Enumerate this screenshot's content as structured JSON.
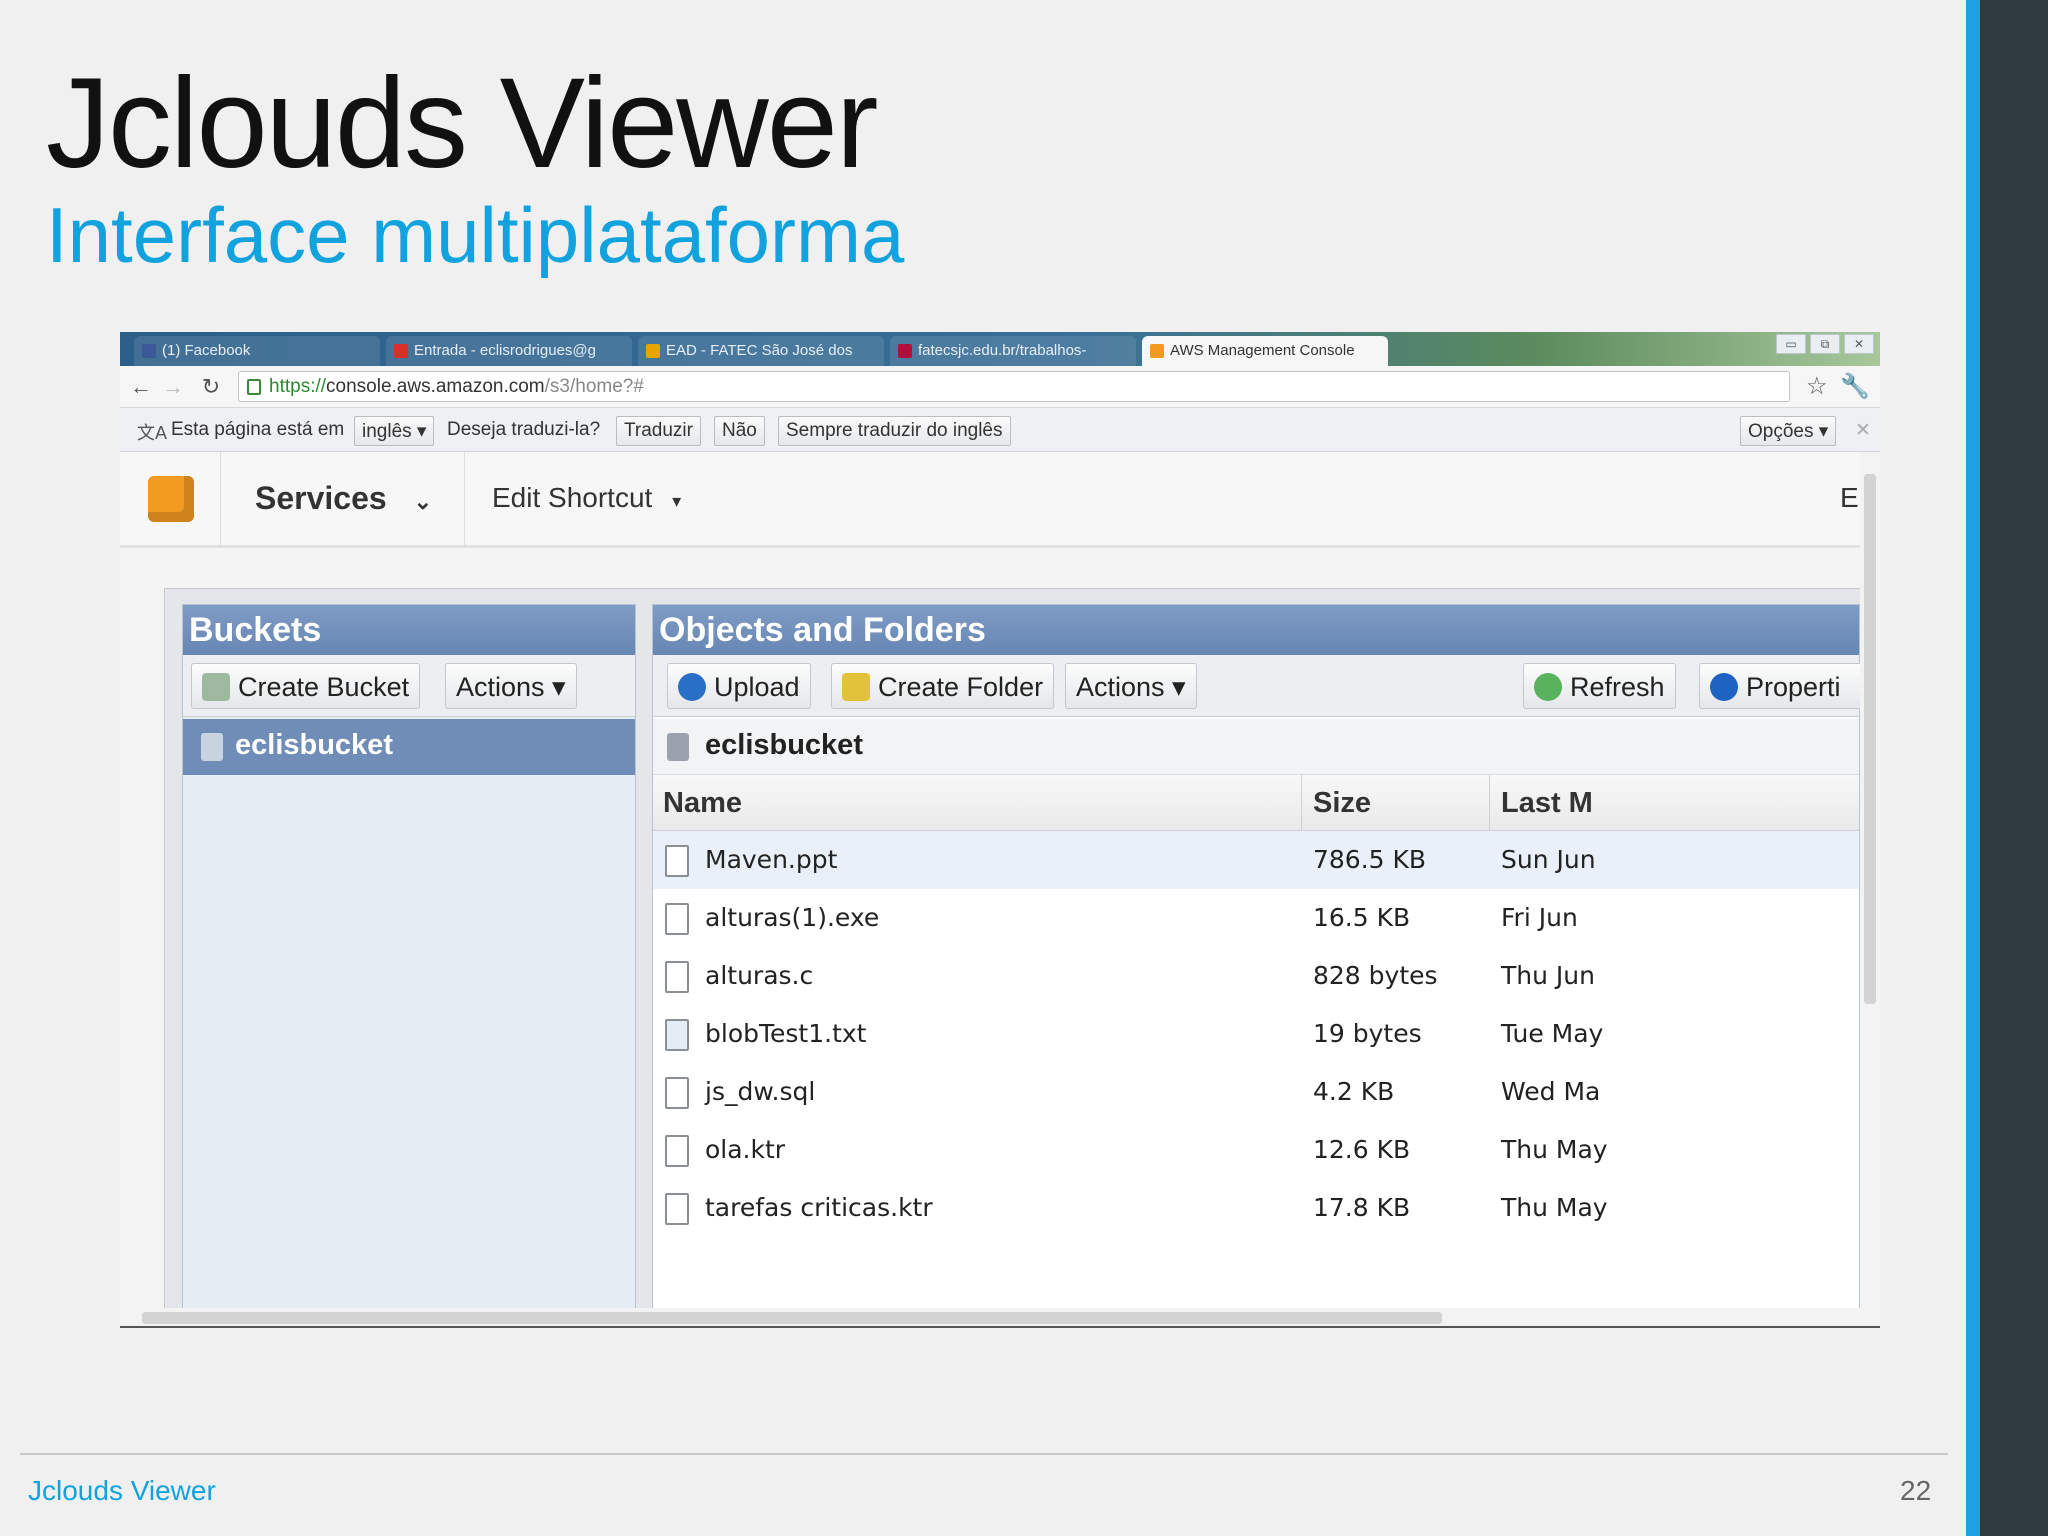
{
  "slide": {
    "title": "Jclouds Viewer",
    "subtitle": "Interface multiplataforma",
    "footer_left": "Jclouds Viewer",
    "page_number": "22"
  },
  "browser": {
    "tabs": [
      {
        "label": "(1) Facebook",
        "icon": "facebook-icon",
        "color": "#3b5998"
      },
      {
        "label": "Entrada - eclisrodrigues@g",
        "icon": "gmail-icon",
        "color": "#d93025"
      },
      {
        "label": "EAD - FATEC São José dos",
        "icon": "moodle-icon",
        "color": "#e8a400"
      },
      {
        "label": "fatecsjc.edu.br/trabalhos-",
        "icon": "fatec-icon",
        "color": "#b0103a"
      },
      {
        "label": "AWS Management Console",
        "icon": "aws-icon",
        "color": "#f29b20"
      }
    ],
    "window_buttons": [
      "▭",
      "⧉",
      "✕"
    ],
    "url": {
      "scheme": "https://",
      "host": "console.aws.amazon.com",
      "path": "/s3/home?#"
    },
    "translate_bar": {
      "text_prefix": "Esta página está em",
      "language": "inglês ▾",
      "question": "Deseja traduzi-la?",
      "translate_button": "Traduzir",
      "no_button": "Não",
      "always_button": "Sempre traduzir do inglês",
      "options_button": "Opções ▾",
      "close": "✕"
    }
  },
  "aws": {
    "services_label": "Services",
    "edit_shortcut_label": "Edit Shortcut",
    "truncated_right": "E",
    "buckets_panel": {
      "title": "Buckets",
      "create_bucket": "Create Bucket",
      "actions": "Actions ▾",
      "buckets": [
        "eclisbucket"
      ]
    },
    "objects_panel": {
      "title": "Objects and Folders",
      "upload": "Upload",
      "create_folder": "Create Folder",
      "actions": "Actions ▾",
      "refresh": "Refresh",
      "properties": "Properti",
      "current_bucket": "eclisbucket",
      "columns": [
        "Name",
        "Size",
        "Last M"
      ],
      "rows": [
        {
          "name": "Maven.ppt",
          "size": "786.5 KB",
          "date": "Sun Jun"
        },
        {
          "name": "alturas(1).exe",
          "size": "16.5 KB",
          "date": "Fri Jun"
        },
        {
          "name": "alturas.c",
          "size": "828 bytes",
          "date": "Thu Jun"
        },
        {
          "name": "blobTest1.txt",
          "size": "19 bytes",
          "date": "Tue May"
        },
        {
          "name": "js_dw.sql",
          "size": "4.2 KB",
          "date": "Wed Ma"
        },
        {
          "name": "ola.ktr",
          "size": "12.6 KB",
          "date": "Thu May"
        },
        {
          "name": "tarefas criticas.ktr",
          "size": "17.8 KB",
          "date": "Thu May"
        }
      ]
    }
  }
}
